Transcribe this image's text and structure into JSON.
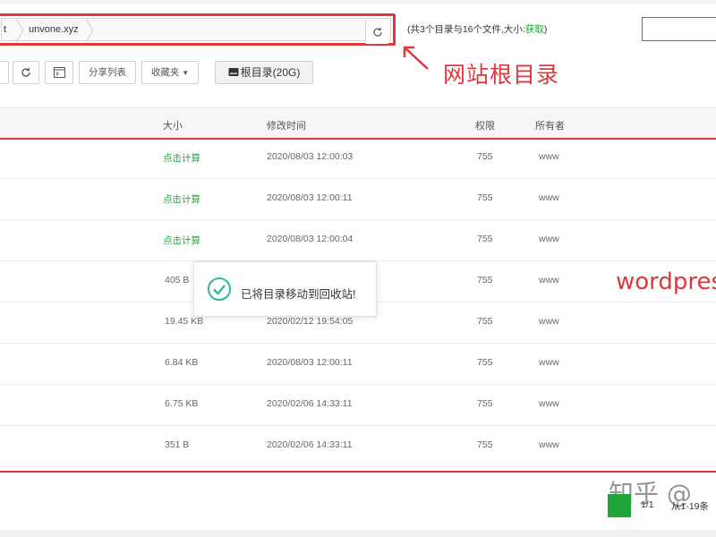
{
  "address_bar": {
    "crumbs": [
      "t",
      "unvone.xyz"
    ],
    "refresh_icon": "refresh-icon"
  },
  "dir_info": {
    "summary": "(共3个目录与16个文件,大小:",
    "fetch_link": "获取",
    "close": ")"
  },
  "annotations": {
    "root_label": "网站根目录",
    "wp_label": "wordpres"
  },
  "toolbar": {
    "refresh_icon": "refresh-icon",
    "terminal_icon": "terminal-icon",
    "share_list": "分享列表",
    "favorites": "收藏夹",
    "root_dir": "根目录(20G)"
  },
  "table": {
    "headers": {
      "size": "大小",
      "modified": "修改时间",
      "perm": "权限",
      "owner": "所有者"
    },
    "rows": [
      {
        "size": "点击计算",
        "modified": "2020/08/03 12:00:03",
        "perm": "755",
        "owner": "www"
      },
      {
        "size": "点击计算",
        "modified": "2020/08/03 12:00:11",
        "perm": "755",
        "owner": "www"
      },
      {
        "size": "点击计算",
        "modified": "2020/08/03 12:00:04",
        "perm": "755",
        "owner": "www"
      },
      {
        "size": "405 B",
        "modified": "",
        "perm": "755",
        "owner": "www"
      },
      {
        "size": "19.45 KB",
        "modified": "2020/02/12 19:54:05",
        "perm": "755",
        "owner": "www"
      },
      {
        "size": "6.84 KB",
        "modified": "2020/08/03 12:00:11",
        "perm": "755",
        "owner": "www"
      },
      {
        "size": "6.75 KB",
        "modified": "2020/02/06 14:33:11",
        "perm": "755",
        "owner": "www"
      },
      {
        "size": "351 B",
        "modified": "2020/02/06 14:33:11",
        "perm": "755",
        "owner": "www"
      }
    ]
  },
  "toast": {
    "message": "已将目录移动到回收站!",
    "icon": "check-circle-icon"
  },
  "pager": {
    "page": "1/1",
    "range": "从1-19条"
  },
  "watermark": "知乎 @",
  "colors": {
    "accent_green": "#20a53a",
    "annotation_red": "#e0373c"
  }
}
